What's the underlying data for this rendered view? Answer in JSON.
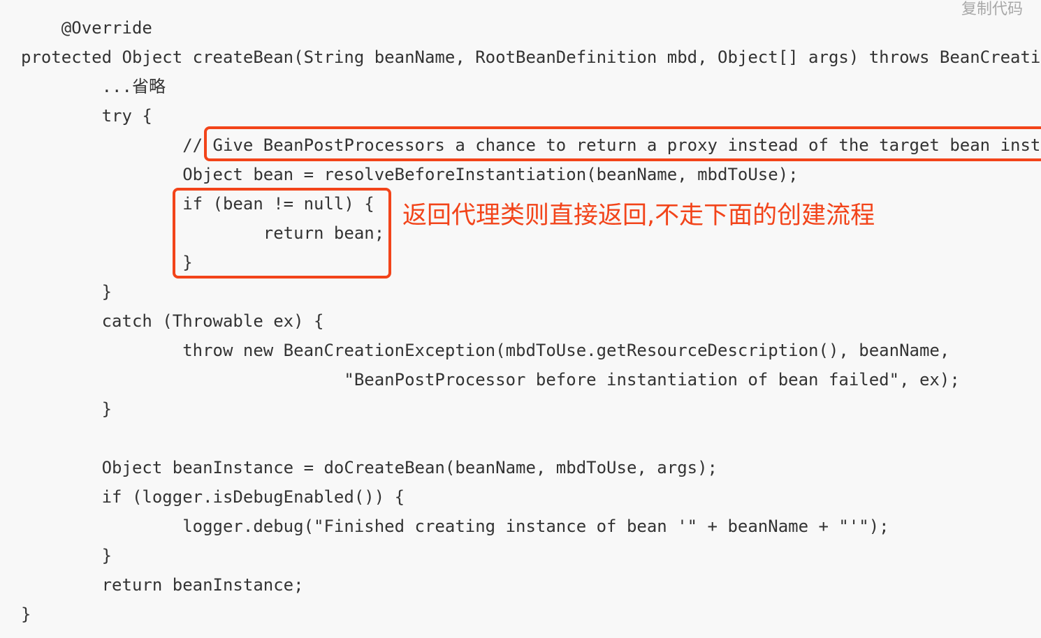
{
  "toolbar": {
    "copy_label": "复制代码"
  },
  "code": {
    "lines": [
      "    @Override",
      "protected Object createBean(String beanName, RootBeanDefinition mbd, Object[] args) throws BeanCreationException {",
      "        ...省略",
      "        try {",
      "                // Give BeanPostProcessors a chance to return a proxy instead of the target bean instance.",
      "                Object bean = resolveBeforeInstantiation(beanName, mbdToUse);",
      "                if (bean != null) {",
      "                        return bean;",
      "                }",
      "        }",
      "        catch (Throwable ex) {",
      "                throw new BeanCreationException(mbdToUse.getResourceDescription(), beanName,",
      "                                \"BeanPostProcessor before instantiation of bean failed\", ex);",
      "        }",
      "",
      "        Object beanInstance = doCreateBean(beanName, mbdToUse, args);",
      "        if (logger.isDebugEnabled()) {",
      "                logger.debug(\"Finished creating instance of bean '\" + beanName + \"'\");",
      "        }",
      "        return beanInstance;",
      "}"
    ]
  },
  "annotations": {
    "proxy_note": "返回代理类则直接返回,不走下面的创建流程"
  },
  "colors": {
    "highlight": "#f2441a",
    "code_text": "#333333",
    "background": "#f8f8f8",
    "copy_text": "#a8a8a8"
  }
}
